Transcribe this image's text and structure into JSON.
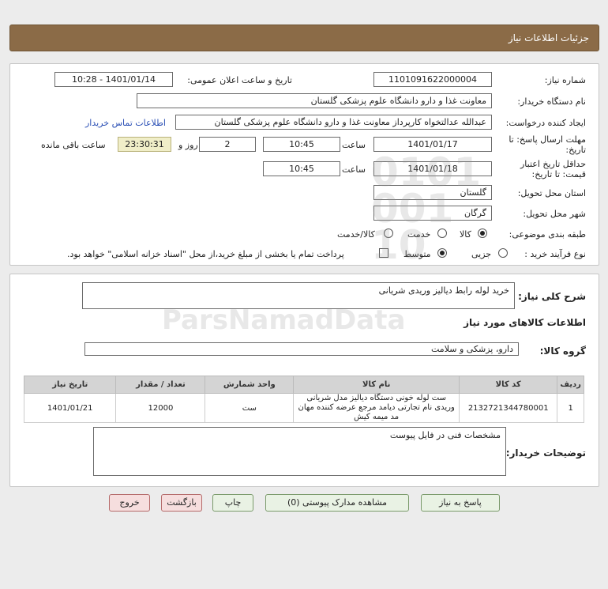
{
  "header": {
    "title": "جزئیات اطلاعات نیاز"
  },
  "form": {
    "need_number_label": "شماره نیاز:",
    "need_number": "1101091622000004",
    "announce_label": "تاریخ و ساعت اعلان عمومی:",
    "announce_value": "1401/01/14 - 10:28",
    "buyer_org_label": "نام دستگاه خریدار:",
    "buyer_org": "معاونت غذا و دارو دانشگاه علوم پزشکی گلستان",
    "creator_label": "ایجاد کننده درخواست:",
    "creator": "عبدالله عدالتخواه کارپرداز معاونت غذا و دارو دانشگاه علوم پزشکی گلستان",
    "contact_link": "اطلاعات تماس خریدار",
    "reply_deadline_label_1": "مهلت ارسال پاسخ: تا",
    "reply_deadline_label_2": "تاریخ:",
    "reply_date": "1401/01/17",
    "time_label": "ساعت",
    "reply_time": "10:45",
    "days": "2",
    "days_label": "روز و",
    "remaining": "23:30:31",
    "remaining_label": "ساعت باقی مانده",
    "validity_label_1": "حداقل تاریخ اعتبار",
    "validity_label_2": "قیمت: تا تاریخ:",
    "validity_date": "1401/01/18",
    "validity_time": "10:45",
    "province_label": "استان محل تحویل:",
    "province": "گلستان",
    "city_label": "شهر محل تحویل:",
    "city": "گرگان",
    "category_label": "طبقه بندی موضوعی:",
    "category_options": [
      "کالا",
      "خدمت",
      "کالا/خدمت"
    ],
    "process_label": "نوع فرآیند خرید :",
    "process_options": [
      "جزیی",
      "متوسط"
    ],
    "payment_note": "پرداخت تمام یا بخشی از مبلغ خرید،از محل \"اسناد خزانه اسلامی\" خواهد بود."
  },
  "summary": {
    "desc_label": "شرح کلی نیاز:",
    "desc": "خرید لوله رابط دیالیز وریدی شریانی",
    "goods_info_title": "اطلاعات کالاهای مورد نیاز",
    "group_label": "گروه کالا:",
    "group": "دارو، پزشکی و سلامت"
  },
  "table": {
    "headers": [
      "ردیف",
      "کد کالا",
      "نام کالا",
      "واحد شمارش",
      "تعداد / مقدار",
      "تاریخ نیاز"
    ],
    "rows": [
      [
        "1",
        "2132721344780001",
        "ست لوله خونی دستگاه دیالیز مدل شریانی وریدی نام تجارتی دیامد مرجع عرضه کننده مهان مد میمه کیش",
        "ست",
        "12000",
        "1401/01/21"
      ]
    ]
  },
  "buyer_notes": {
    "label": "توضیحات خریدار:",
    "text": "مشخصات فنی  در فایل پیوست"
  },
  "buttons": {
    "reply": "پاسخ به نیاز",
    "attachments": "مشاهده مدارک پیوستی (0)",
    "print": "چاپ",
    "back": "بازگشت",
    "exit": "خروج"
  },
  "watermark": {
    "brand": "ParsNamadData"
  }
}
